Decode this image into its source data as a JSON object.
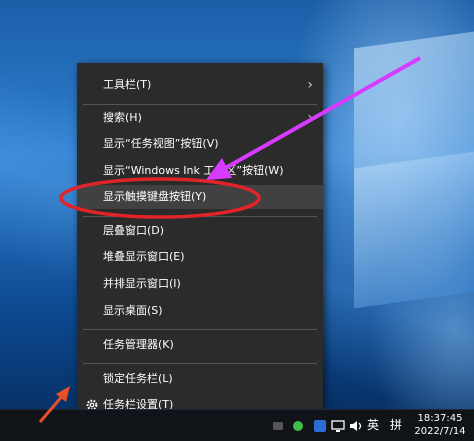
{
  "context_menu": {
    "items": [
      {
        "label": "工具栏(T)"
      },
      {
        "label": "搜索(H)"
      },
      {
        "label": "显示“任务视图”按钮(V)"
      },
      {
        "label": "显示“Windows Ink 工作区”按钮(W)"
      },
      {
        "label": "显示触摸键盘按钮(Y)"
      },
      {
        "label": "层叠窗口(D)"
      },
      {
        "label": "堆叠显示窗口(E)"
      },
      {
        "label": "并排显示窗口(I)"
      },
      {
        "label": "显示桌面(S)"
      },
      {
        "label": "任务管理器(K)"
      },
      {
        "label": "锁定任务栏(L)"
      },
      {
        "label": "任务栏设置(T)"
      }
    ]
  },
  "taskbar": {
    "ime_lang": "英",
    "ime_mode": "拼",
    "time": "18:37:45",
    "date": "2022/7/14"
  },
  "colors": {
    "menu_bg": "#2b2b2b",
    "highlight": "#414141",
    "annotation_arrow": "#d63bff",
    "annotation_circle": "#e0242a",
    "pointer_arrow": "#e8502a"
  },
  "icons": [
    "chevron-right-icon",
    "gear-icon",
    "network-icon",
    "volume-icon",
    "notification-icon",
    "security-icon"
  ]
}
